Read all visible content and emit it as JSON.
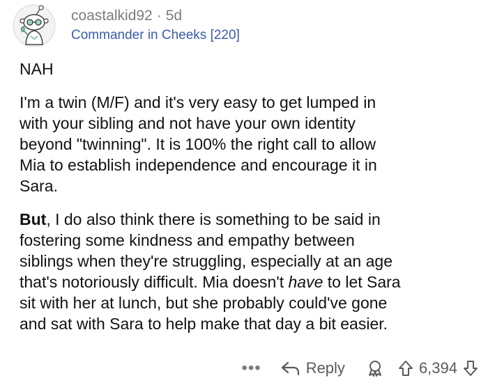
{
  "comment": {
    "username": "coastalkid92",
    "separator": "·",
    "age": "5d",
    "flair": "Commander in Cheeks [220]",
    "verdict": "NAH",
    "paragraph2_lines": [
      "I'm a twin (M/F) and it's very easy to get lumped in",
      "with your sibling and not have your own identity",
      "beyond \"twinning\". It is 100% the right call to allow",
      "Mia to establish independence and encourage it in",
      "Sara."
    ],
    "paragraph3": {
      "bold_lead": "But",
      "line1_rest": ", I do also think there is something to be said in",
      "line2": "fostering some kindness and empathy between",
      "line3": "siblings when they're struggling, especially at an age",
      "line4_before_italic": "that's notoriously difficult. Mia doesn't ",
      "line4_italic": "have",
      "line4_after_italic": " to let Sara",
      "line5": "sit with her at lunch, but she probably could've gone",
      "line6": "and sat with Sara to help make that day a bit easier."
    },
    "actions": {
      "more_label": "•••",
      "reply_label": "Reply",
      "score": "6,394"
    }
  },
  "icons": {
    "avatar": "snoo-avatar-icon",
    "reply": "reply-arrow-icon",
    "award": "award-icon",
    "upvote": "upvote-arrow-icon",
    "downvote": "downvote-arrow-icon"
  },
  "colors": {
    "username": "#7c7c7c",
    "flair": "#3a5da8",
    "text": "#111111",
    "actions": "#5a5a5a"
  }
}
